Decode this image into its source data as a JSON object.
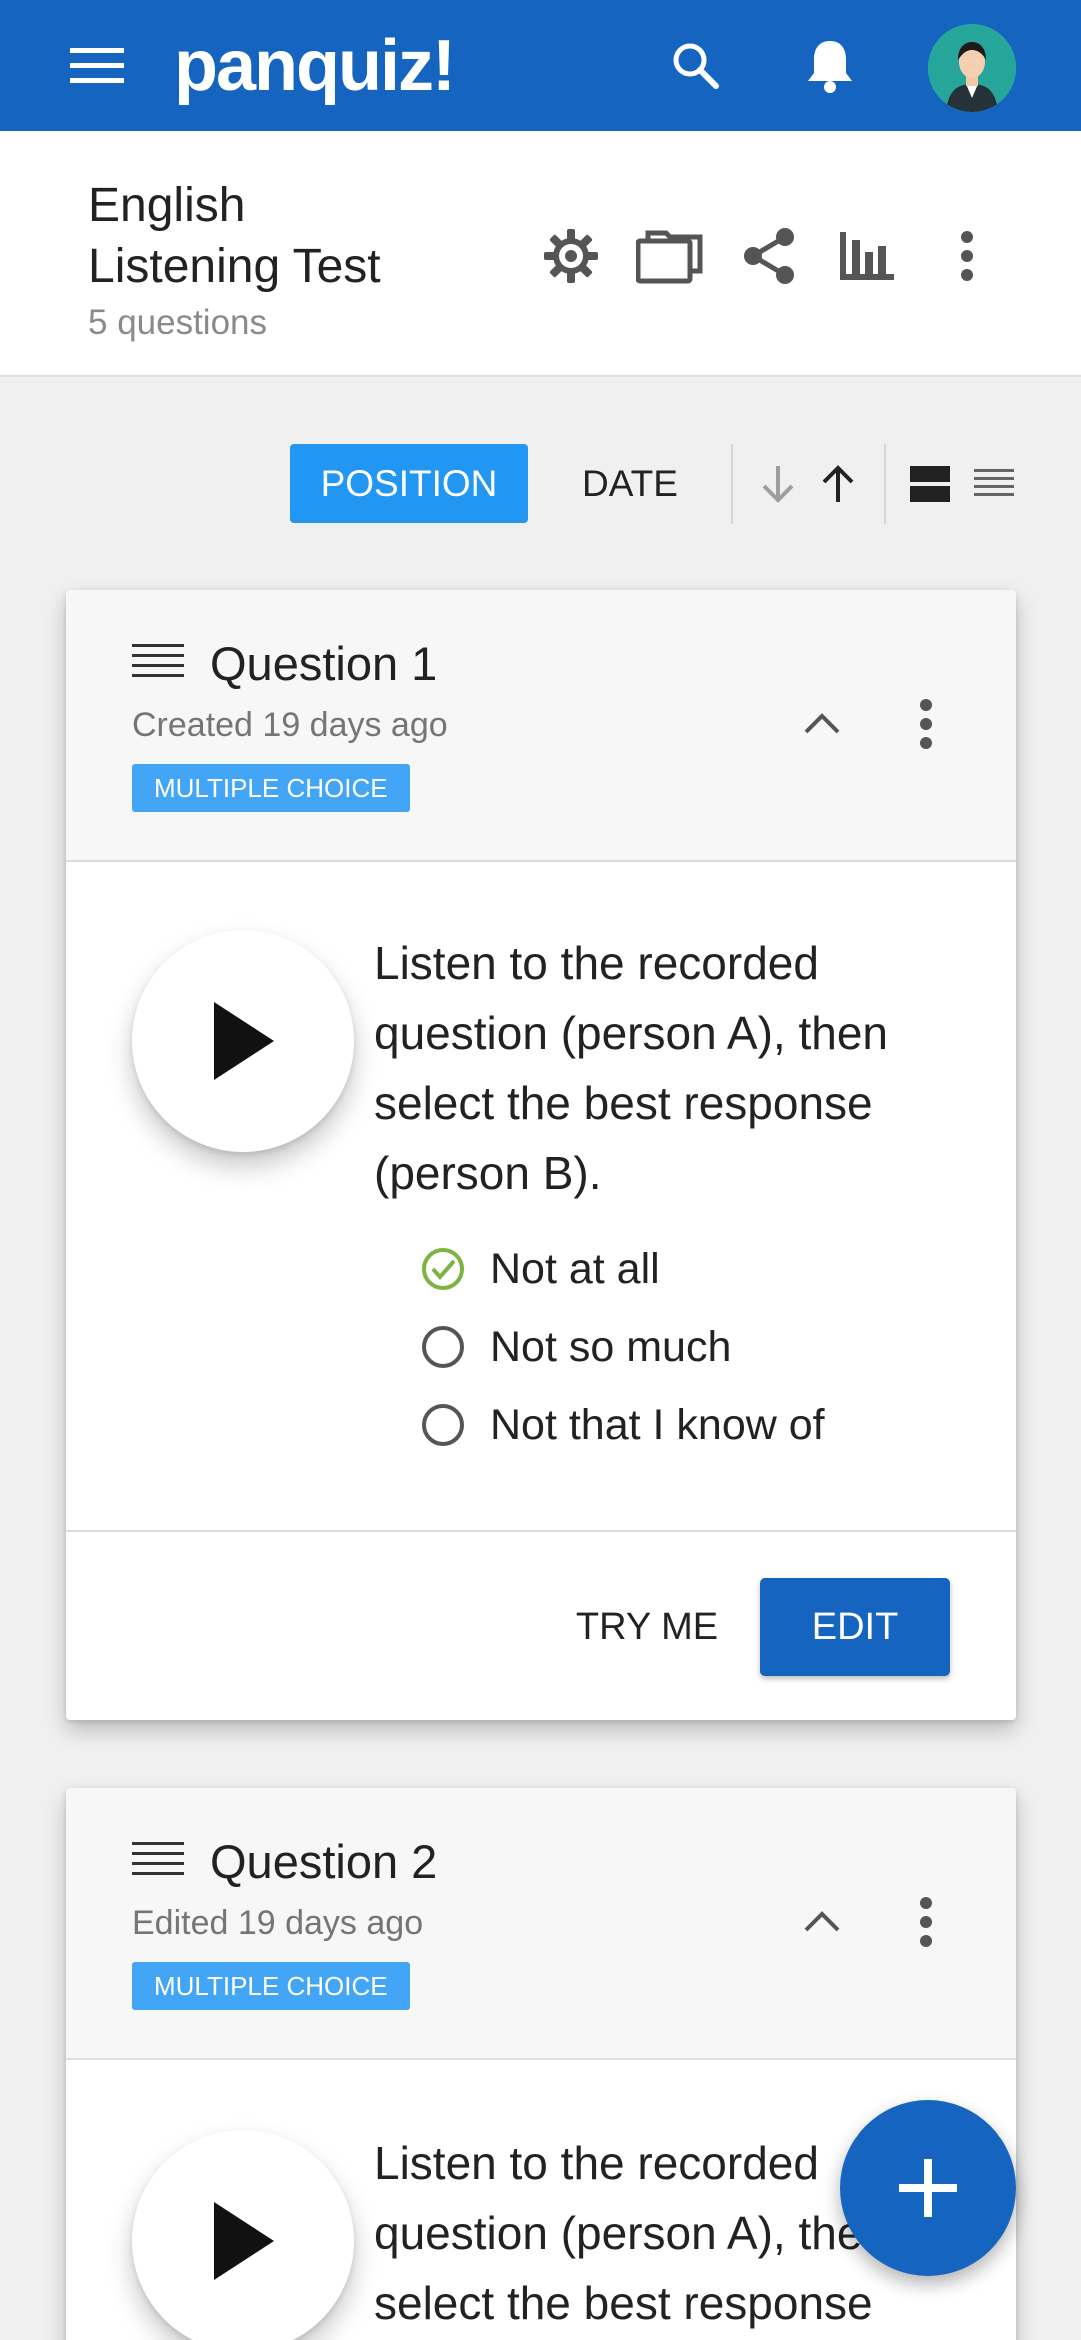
{
  "app": {
    "logo": "panquiz!",
    "colors": {
      "primary": "#1565c0",
      "accent": "#2196f3",
      "badge": "#42a5f5",
      "check": "#7cb342"
    },
    "icons": [
      "menu-icon",
      "search-icon",
      "bell-icon",
      "avatar"
    ]
  },
  "quiz": {
    "title": "English Listening Test",
    "subtitle": "5 questions",
    "actions": [
      "gear-icon",
      "folder-icon",
      "share-icon",
      "chart-icon",
      "more-vert-icon"
    ]
  },
  "toolbar": {
    "position_label": "POSITION",
    "date_label": "DATE",
    "sort_icons": [
      "arrow-down-icon",
      "arrow-up-icon"
    ],
    "view_icons": [
      "view-cards-icon",
      "view-list-icon"
    ]
  },
  "questions": [
    {
      "title": "Question 1",
      "meta": "Created 19 days ago",
      "badge": "MULTIPLE CHOICE",
      "text": "Listen to the recorded question (person A), then select the best response (person B).",
      "options": [
        {
          "label": "Not at all",
          "correct": true
        },
        {
          "label": "Not so much",
          "correct": false
        },
        {
          "label": "Not that I know of",
          "correct": false
        }
      ],
      "try_label": "TRY ME",
      "edit_label": "EDIT"
    },
    {
      "title": "Question 2",
      "meta": "Edited 19 days ago",
      "badge": "MULTIPLE CHOICE",
      "text": "Listen to the recorded question (person A), then select the best response"
    }
  ]
}
